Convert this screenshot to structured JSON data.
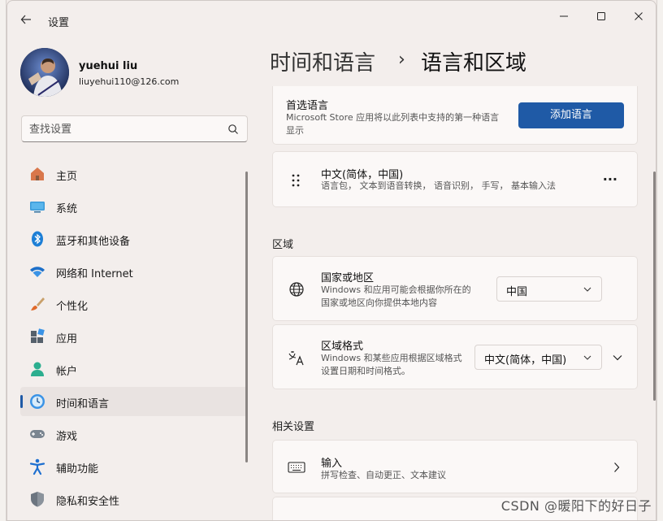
{
  "window": {
    "app_title": "设置"
  },
  "user": {
    "name": "yuehui liu",
    "email": "liuyehui110@126.com"
  },
  "search": {
    "placeholder": "查找设置"
  },
  "nav": {
    "items": [
      {
        "label": "主页",
        "icon": "home-icon"
      },
      {
        "label": "系统",
        "icon": "system-icon"
      },
      {
        "label": "蓝牙和其他设备",
        "icon": "bluetooth-icon"
      },
      {
        "label": "网络和 Internet",
        "icon": "wifi-icon"
      },
      {
        "label": "个性化",
        "icon": "brush-icon"
      },
      {
        "label": "应用",
        "icon": "apps-icon"
      },
      {
        "label": "帐户",
        "icon": "account-icon"
      },
      {
        "label": "时间和语言",
        "icon": "time-language-icon",
        "active": true
      },
      {
        "label": "游戏",
        "icon": "gaming-icon"
      },
      {
        "label": "辅助功能",
        "icon": "accessibility-icon"
      },
      {
        "label": "隐私和安全性",
        "icon": "shield-icon"
      }
    ]
  },
  "breadcrumb": {
    "parent": "时间和语言",
    "separator": "›",
    "current": "语言和区域"
  },
  "preferred_language": {
    "title": "首选语言",
    "desc": "Microsoft Store 应用将以此列表中支持的第一种语言显示",
    "add_button": "添加语言"
  },
  "language_item": {
    "title": "中文(简体，中国)",
    "desc": "语言包， 文本到语音转换， 语音识别， 手写， 基本输入法",
    "more": "···"
  },
  "region": {
    "header": "区域",
    "country": {
      "title": "国家或地区",
      "desc": "Windows 和应用可能会根据你所在的国家或地区向你提供本地内容",
      "value": "中国"
    },
    "format": {
      "title": "区域格式",
      "desc": "Windows 和某些应用根据区域格式设置日期和时间格式。",
      "value": "中文(简体，中国)"
    }
  },
  "related": {
    "header": "相关设置",
    "input": {
      "title": "输入",
      "desc": "拼写检查、自动更正、文本建议"
    }
  },
  "watermark": "CSDN @暖阳下的好日子",
  "colors": {
    "accent": "#1f5aa6",
    "window_bg": "#f3eeec",
    "card_bg": "#fbf8f7"
  }
}
